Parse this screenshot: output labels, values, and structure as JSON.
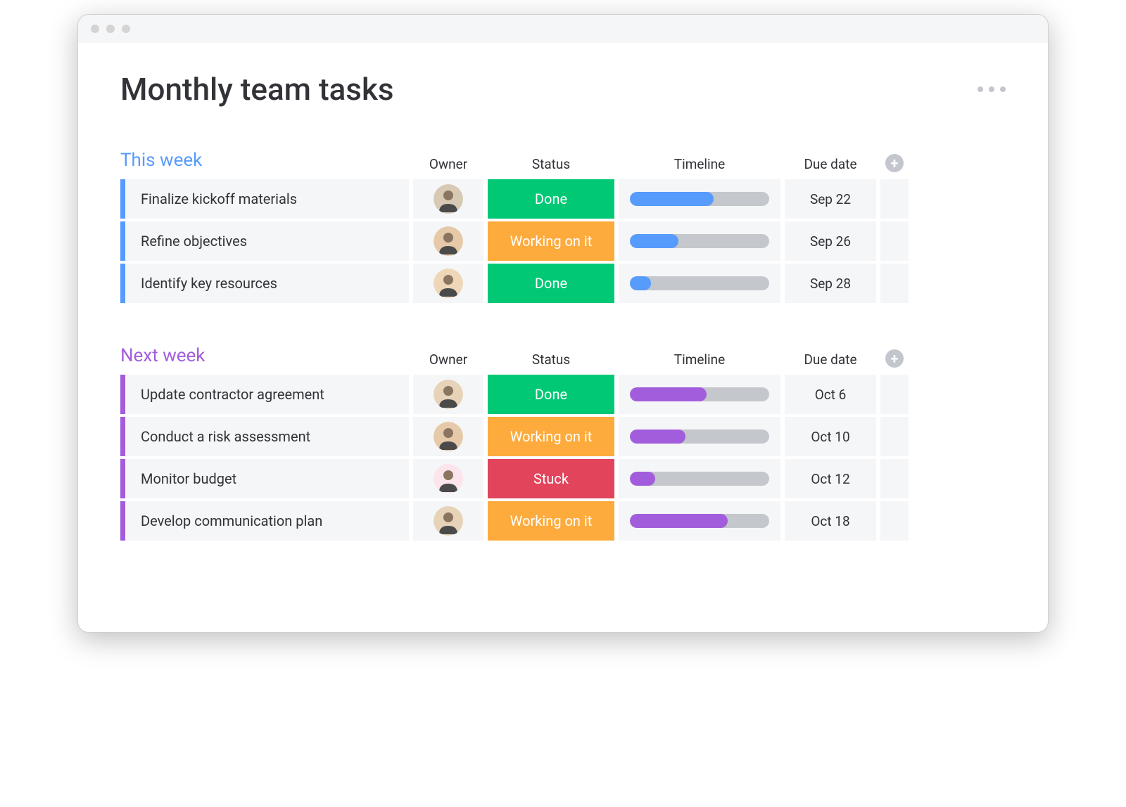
{
  "page": {
    "title": "Monthly team tasks"
  },
  "columns": {
    "owner": "Owner",
    "status": "Status",
    "timeline": "Timeline",
    "due": "Due date"
  },
  "status_colors": {
    "done": "#00c875",
    "working": "#fdab3d",
    "stuck": "#e2445c"
  },
  "groups": [
    {
      "title": "This week",
      "color": "#579bfc",
      "rows": [
        {
          "name": "Finalize kickoff materials",
          "owner_bg": "#d8c9b4",
          "status_label": "Done",
          "status_color": "#00c875",
          "timeline_pct": 60,
          "timeline_color": "#579bfc",
          "due": "Sep 22"
        },
        {
          "name": "Refine objectives",
          "owner_bg": "#e6c9a8",
          "status_label": "Working on it",
          "status_color": "#fdab3d",
          "timeline_pct": 35,
          "timeline_color": "#579bfc",
          "due": "Sep 26"
        },
        {
          "name": "Identify key resources",
          "owner_bg": "#f0d6b8",
          "status_label": "Done",
          "status_color": "#00c875",
          "timeline_pct": 15,
          "timeline_color": "#579bfc",
          "due": "Sep 28"
        }
      ]
    },
    {
      "title": "Next week",
      "color": "#a25ddc",
      "rows": [
        {
          "name": "Update contractor agreement",
          "owner_bg": "#e6d3b8",
          "status_label": "Done",
          "status_color": "#00c875",
          "timeline_pct": 55,
          "timeline_color": "#a25ddc",
          "due": "Oct 6"
        },
        {
          "name": "Conduct a risk assessment",
          "owner_bg": "#e6c9a8",
          "status_label": "Working on it",
          "status_color": "#fdab3d",
          "timeline_pct": 40,
          "timeline_color": "#a25ddc",
          "due": "Oct 10"
        },
        {
          "name": "Monitor budget",
          "owner_bg": "#fce4ec",
          "status_label": "Stuck",
          "status_color": "#e2445c",
          "timeline_pct": 18,
          "timeline_color": "#a25ddc",
          "due": "Oct 12"
        },
        {
          "name": "Develop communication plan",
          "owner_bg": "#e6d3b8",
          "status_label": "Working on it",
          "status_color": "#fdab3d",
          "timeline_pct": 70,
          "timeline_color": "#a25ddc",
          "due": "Oct 18"
        }
      ]
    }
  ]
}
